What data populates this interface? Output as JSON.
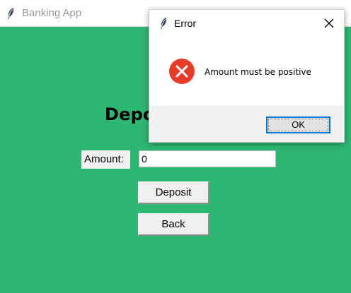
{
  "main_window": {
    "title": "Banking App",
    "heading": "Depo",
    "amount_label": "Amount:",
    "amount_value": "0",
    "deposit_label": "Deposit",
    "back_label": "Back"
  },
  "dialog": {
    "title": "Error",
    "message": "Amount must be positive",
    "ok_label": "OK",
    "icons": {
      "title": "feather-icon",
      "close": "close-icon",
      "status": "error-icon"
    }
  },
  "colors": {
    "background": "#2eb673",
    "error": "#e83c2a",
    "focus": "#0078d7"
  }
}
